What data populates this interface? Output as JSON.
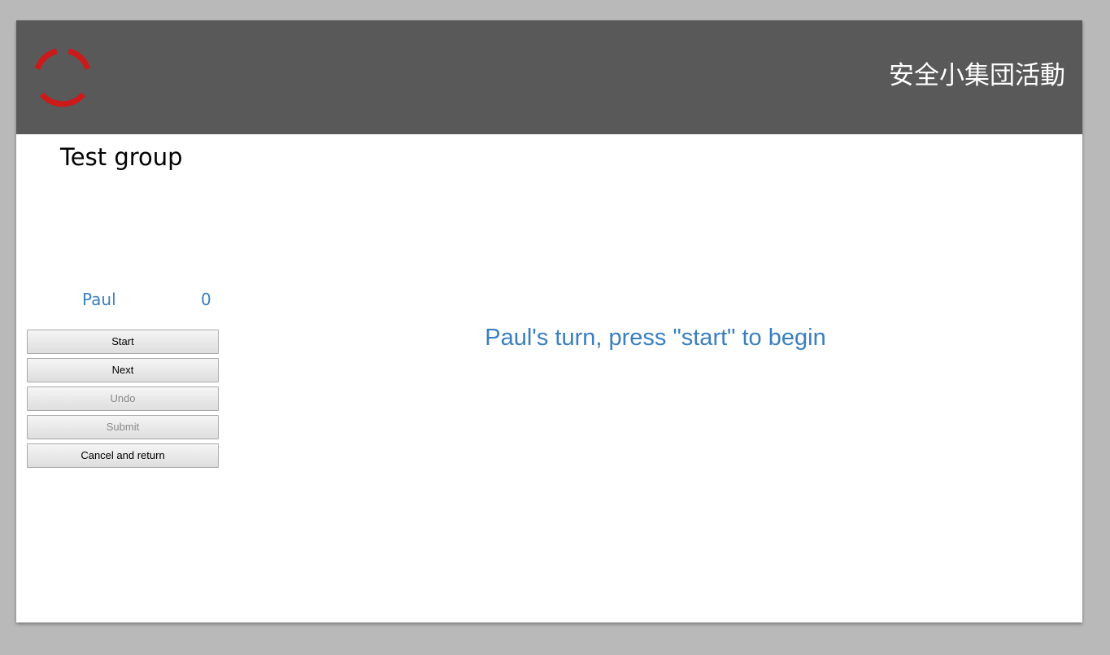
{
  "header": {
    "app_title": "安全小集団活動",
    "logo_icon": "red-ring-logo-icon",
    "background_color": "#595959",
    "logo_color": "#cc1a1a"
  },
  "group": {
    "title": "Test group"
  },
  "players": [
    {
      "name": "Paul",
      "score": "0"
    }
  ],
  "controls": {
    "start_label": "Start",
    "next_label": "Next",
    "undo_label": "Undo",
    "submit_label": "Submit",
    "cancel_label": "Cancel and return"
  },
  "main": {
    "message": "Paul's turn, press \"start\" to begin"
  },
  "colors": {
    "accent": "#3a7fbf",
    "page_background": "#b9b9b9"
  }
}
